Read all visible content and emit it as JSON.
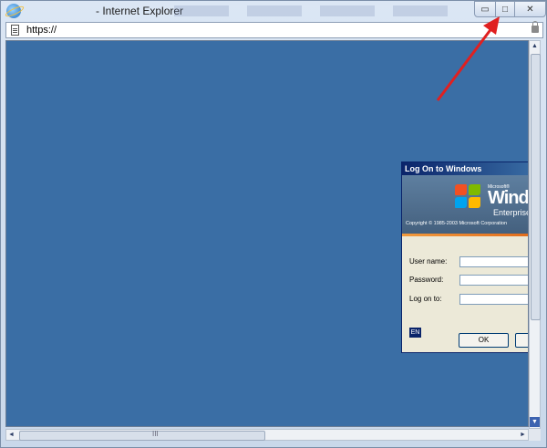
{
  "window": {
    "title": "- Internet Explorer",
    "url": "https://",
    "controls": {
      "minimize": "▭",
      "maximize": "□",
      "close": "✕"
    }
  },
  "icons": {
    "app": "ie-logo-icon",
    "page": "page-icon",
    "lock": "lock-icon"
  },
  "logon_dialog": {
    "title": "Log On to Windows",
    "brand_small": "Microsoft®",
    "brand_large": "Windows",
    "brand_edition": "Enterprise",
    "copyright": "Copyright © 1985-2003  Microsoft Corporation",
    "fields": [
      {
        "label": "User name:",
        "value": ""
      },
      {
        "label": "Password:",
        "value": ""
      },
      {
        "label": "Log on to:",
        "value": ""
      }
    ],
    "language": "EN",
    "buttons": {
      "ok": "OK",
      "cancel": "C"
    }
  },
  "scrollbar": {
    "grip": "III"
  },
  "colors": {
    "desktop": "#3a6ea5",
    "annotation_arrow": "#e02020"
  }
}
